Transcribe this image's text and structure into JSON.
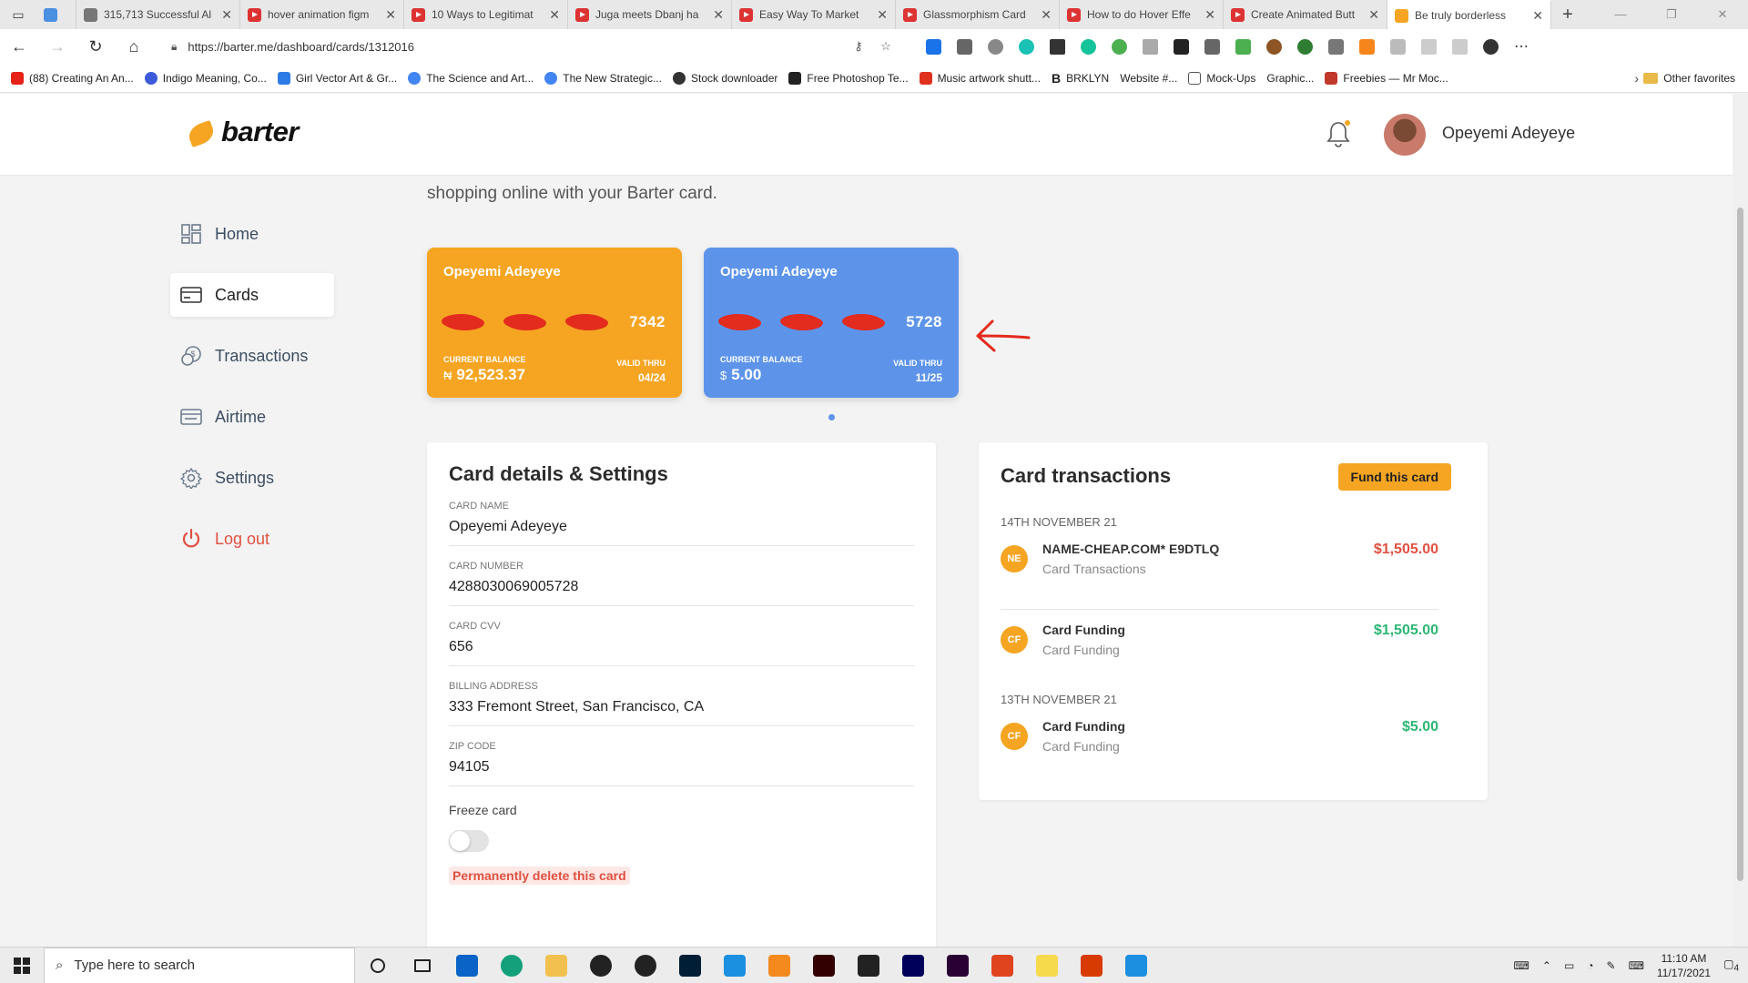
{
  "browser": {
    "tabs": [
      {
        "title": "",
        "icon": "droplet-icon",
        "color": "#4a8fe0"
      },
      {
        "title": "315,713 Successful Al",
        "icon": "s-icon",
        "color": "#777777"
      },
      {
        "title": "hover animation figm",
        "icon": "youtube-icon",
        "color": "#e62117"
      },
      {
        "title": "10 Ways to Legitimat",
        "icon": "youtube-icon",
        "color": "#e62117"
      },
      {
        "title": "Juga meets Dbanj ha",
        "icon": "youtube-icon",
        "color": "#e62117"
      },
      {
        "title": "Easy Way To Market",
        "icon": "youtube-icon",
        "color": "#e62117"
      },
      {
        "title": "Glassmorphism Card",
        "icon": "youtube-icon",
        "color": "#e62117"
      },
      {
        "title": "How to do Hover Effe",
        "icon": "youtube-icon",
        "color": "#e62117"
      },
      {
        "title": "Create Animated Butt",
        "icon": "youtube-icon",
        "color": "#e62117"
      },
      {
        "title": "Be truly borderless",
        "icon": "barter-icon",
        "color": "#f5a522",
        "active": true
      }
    ],
    "url": "https://barter.me/dashboard/cards/1312016",
    "bookmarks": [
      {
        "label": "(88) Creating An An...",
        "color": "#e62117"
      },
      {
        "label": "Indigo Meaning, Co...",
        "color": "#3b5bdb"
      },
      {
        "label": "Girl Vector Art & Gr...",
        "color": "#2d7be5"
      },
      {
        "label": "The Science and Art...",
        "color": "#4285f4"
      },
      {
        "label": "The New Strategic...",
        "color": "#4285f4"
      },
      {
        "label": "Stock downloader",
        "color": "#333333"
      },
      {
        "label": "Free Photoshop Te...",
        "color": "#222222"
      },
      {
        "label": "Music artwork shutt...",
        "color": "#e0301e"
      },
      {
        "label": "BRKLYN",
        "color": "#111111"
      },
      {
        "label": "Website #...",
        "color": "#ffffff"
      },
      {
        "label": "Mock-Ups",
        "color": "#555555"
      },
      {
        "label": "Graphic...",
        "color": "#ffffff"
      },
      {
        "label": "Freebies — Mr Moc...",
        "color": "#c0392b"
      }
    ],
    "other_favorites": "Other favorites"
  },
  "header": {
    "brand": "barter",
    "user_name": "Opeyemi Adeyeye"
  },
  "sidebar": {
    "items": [
      {
        "label": "Home",
        "icon": "home-grid-icon"
      },
      {
        "label": "Cards",
        "icon": "card-icon",
        "active": true
      },
      {
        "label": "Transactions",
        "icon": "coins-icon"
      },
      {
        "label": "Airtime",
        "icon": "airtime-icon"
      },
      {
        "label": "Settings",
        "icon": "gear-icon"
      },
      {
        "label": "Log out",
        "icon": "power-icon"
      }
    ]
  },
  "intro_text": "shopping online with your Barter card.",
  "cards": [
    {
      "holder": "Opeyemi Adeyeye",
      "last4": "7342",
      "balance_label": "CURRENT BALANCE",
      "currency": "₦",
      "balance": "92,523.37",
      "valid_label": "VALID THRU",
      "valid": "04/24",
      "color": "#f5a522"
    },
    {
      "holder": "Opeyemi Adeyeye",
      "last4": "5728",
      "balance_label": "CURRENT BALANCE",
      "currency": "$",
      "balance": "5.00",
      "valid_label": "VALID THRU",
      "valid": "11/25",
      "color": "#5d94ea"
    }
  ],
  "details": {
    "title": "Card details & Settings",
    "fields": [
      {
        "label": "CARD NAME",
        "value": "Opeyemi Adeyeye"
      },
      {
        "label": "CARD NUMBER",
        "value": "4288030069005728"
      },
      {
        "label": "CARD CVV",
        "value": "656"
      },
      {
        "label": "BILLING ADDRESS",
        "value": "333 Fremont Street, San Francisco, CA"
      },
      {
        "label": "ZIP CODE",
        "value": "94105"
      }
    ],
    "freeze_label": "Freeze card",
    "freeze_on": false,
    "delete_label": "Permanently delete this card"
  },
  "transactions": {
    "title": "Card transactions",
    "fund_label": "Fund this card",
    "groups": [
      {
        "date": "14TH NOVEMBER 21",
        "items": [
          {
            "badge": "NE",
            "name": "NAME-CHEAP.COM* E9DTLQ",
            "sub": "Card Transactions",
            "amount": "$1,505.00",
            "type": "debit"
          },
          {
            "badge": "CF",
            "name": "Card Funding",
            "sub": "Card Funding",
            "amount": "$1,505.00",
            "type": "credit"
          }
        ]
      },
      {
        "date": "13TH NOVEMBER 21",
        "items": [
          {
            "badge": "CF",
            "name": "Card Funding",
            "sub": "Card Funding",
            "amount": "$5.00",
            "type": "credit"
          }
        ]
      }
    ]
  },
  "taskbar": {
    "search_placeholder": "Type here to search",
    "time": "11:10 AM",
    "date": "11/17/2021",
    "notifications": "4"
  },
  "colors": {
    "accent": "#f5a522",
    "blue_card": "#5d94ea",
    "debit": "#e05040",
    "credit": "#2bb673"
  }
}
